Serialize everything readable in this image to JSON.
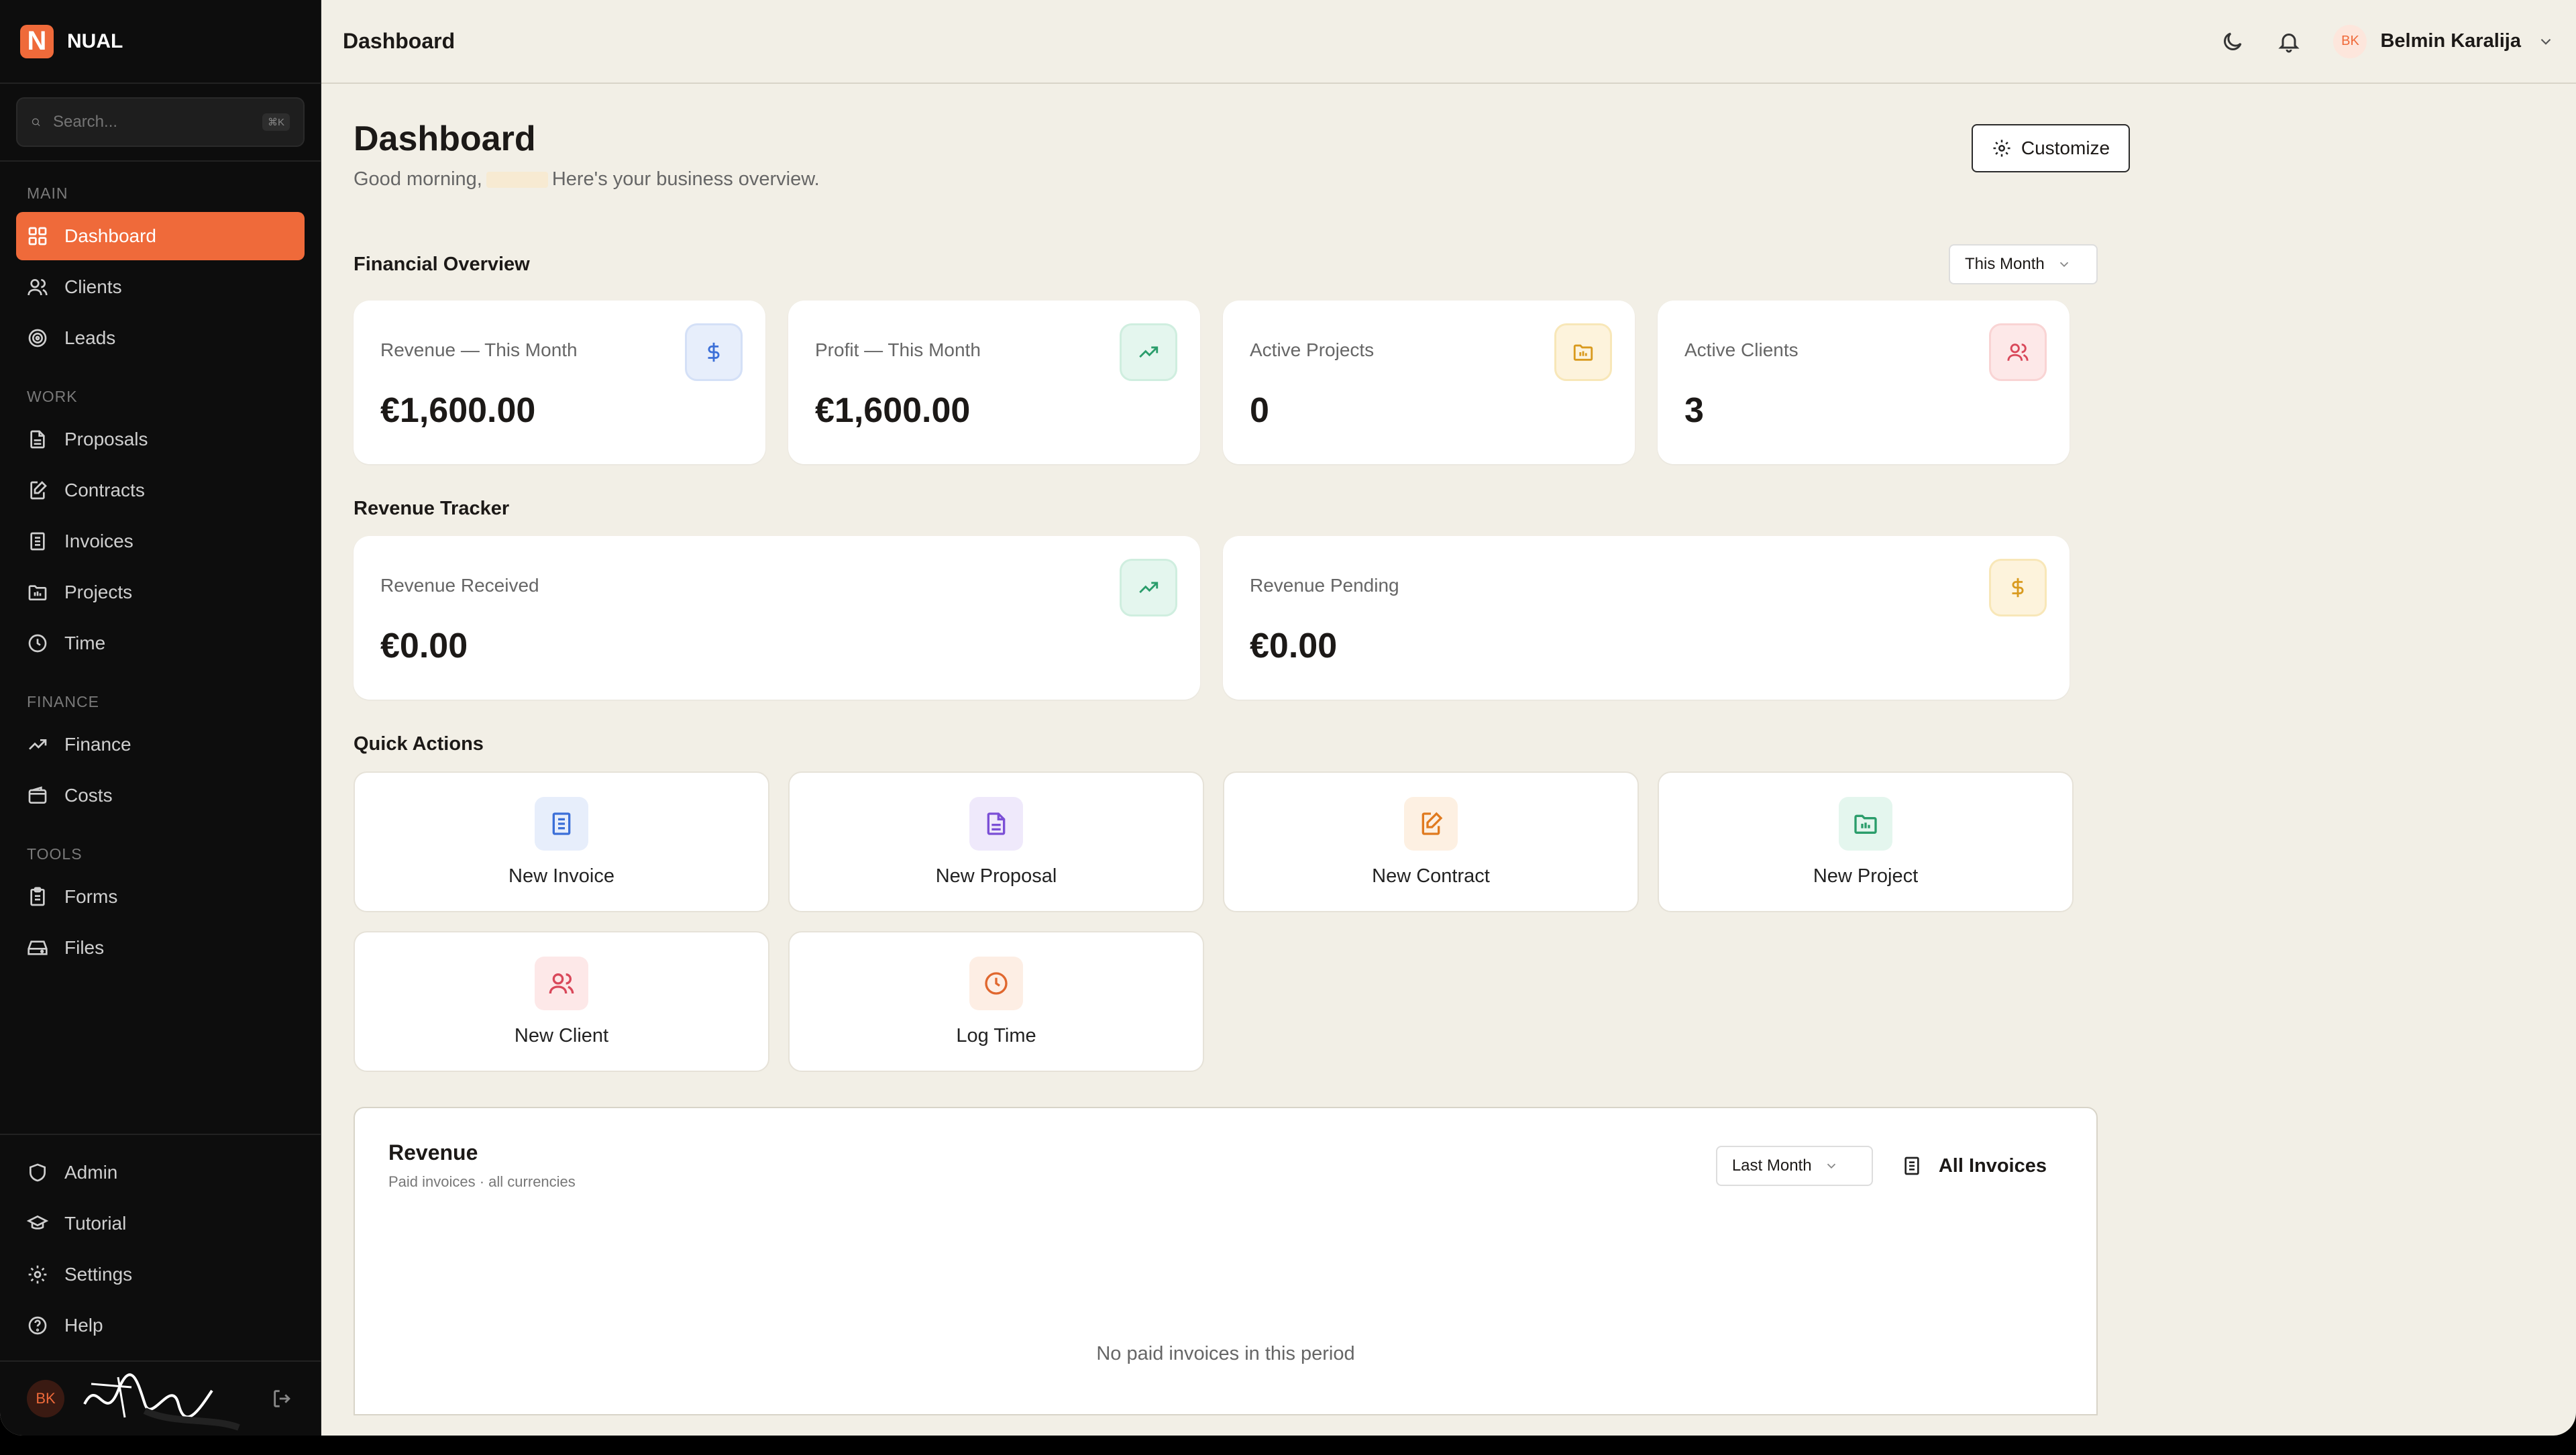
{
  "brand": {
    "logo_letter": "N",
    "name": "NUAL"
  },
  "search": {
    "placeholder": "Search...",
    "shortcut": "⌘K"
  },
  "sidebar": {
    "sections": [
      {
        "label": "MAIN",
        "items": [
          {
            "label": "Dashboard",
            "icon": "grid-icon",
            "active": true
          },
          {
            "label": "Clients",
            "icon": "users-icon"
          },
          {
            "label": "Leads",
            "icon": "target-icon"
          }
        ]
      },
      {
        "label": "WORK",
        "items": [
          {
            "label": "Proposals",
            "icon": "document-icon"
          },
          {
            "label": "Contracts",
            "icon": "edit-document-icon"
          },
          {
            "label": "Invoices",
            "icon": "receipt-icon"
          },
          {
            "label": "Projects",
            "icon": "folder-icon"
          },
          {
            "label": "Time",
            "icon": "clock-icon"
          }
        ]
      },
      {
        "label": "FINANCE",
        "items": [
          {
            "label": "Finance",
            "icon": "trend-icon"
          },
          {
            "label": "Costs",
            "icon": "wallet-icon"
          }
        ]
      },
      {
        "label": "TOOLS",
        "items": [
          {
            "label": "Forms",
            "icon": "clipboard-icon"
          },
          {
            "label": "Files",
            "icon": "drive-icon"
          }
        ]
      }
    ],
    "bottom_items": [
      {
        "label": "Admin",
        "icon": "shield-icon"
      },
      {
        "label": "Tutorial",
        "icon": "graduation-icon"
      },
      {
        "label": "Settings",
        "icon": "gear-icon"
      },
      {
        "label": "Help",
        "icon": "help-icon"
      }
    ],
    "user_initials": "BK"
  },
  "topbar": {
    "title": "Dashboard",
    "user_initials": "BK",
    "user_name": "Belmin Karalija"
  },
  "page": {
    "title": "Dashboard",
    "greeting_prefix": "Good morning,",
    "greeting_suffix": "Here's your business overview.",
    "customize_label": "Customize"
  },
  "financial_overview": {
    "title": "Financial Overview",
    "period": "This Month",
    "cards": [
      {
        "label": "Revenue — This Month",
        "value": "€1,600.00",
        "icon": "dollar-icon"
      },
      {
        "label": "Profit — This Month",
        "value": "€1,600.00",
        "icon": "trend-icon"
      },
      {
        "label": "Active Projects",
        "value": "0",
        "icon": "folder-icon"
      },
      {
        "label": "Active Clients",
        "value": "3",
        "icon": "users-icon"
      }
    ]
  },
  "revenue_tracker": {
    "title": "Revenue Tracker",
    "cards": [
      {
        "label": "Revenue Received",
        "value": "€0.00",
        "icon": "trend-icon"
      },
      {
        "label": "Revenue Pending",
        "value": "€0.00",
        "icon": "dollar-icon"
      }
    ]
  },
  "quick_actions": {
    "title": "Quick Actions",
    "items": [
      {
        "label": "New Invoice",
        "icon": "receipt-icon"
      },
      {
        "label": "New Proposal",
        "icon": "document-icon"
      },
      {
        "label": "New Contract",
        "icon": "edit-document-icon"
      },
      {
        "label": "New Project",
        "icon": "folder-icon"
      },
      {
        "label": "New Client",
        "icon": "users-icon"
      },
      {
        "label": "Log Time",
        "icon": "clock-icon"
      }
    ]
  },
  "revenue_panel": {
    "title": "Revenue",
    "subtitle": "Paid invoices · all currencies",
    "period": "Last Month",
    "all_invoices_label": "All Invoices",
    "empty_text": "No paid invoices in this period"
  },
  "colors": {
    "accent": "#ef6a3a",
    "sidebar_bg": "#0d0d0d",
    "page_bg": "#f2efe6"
  }
}
